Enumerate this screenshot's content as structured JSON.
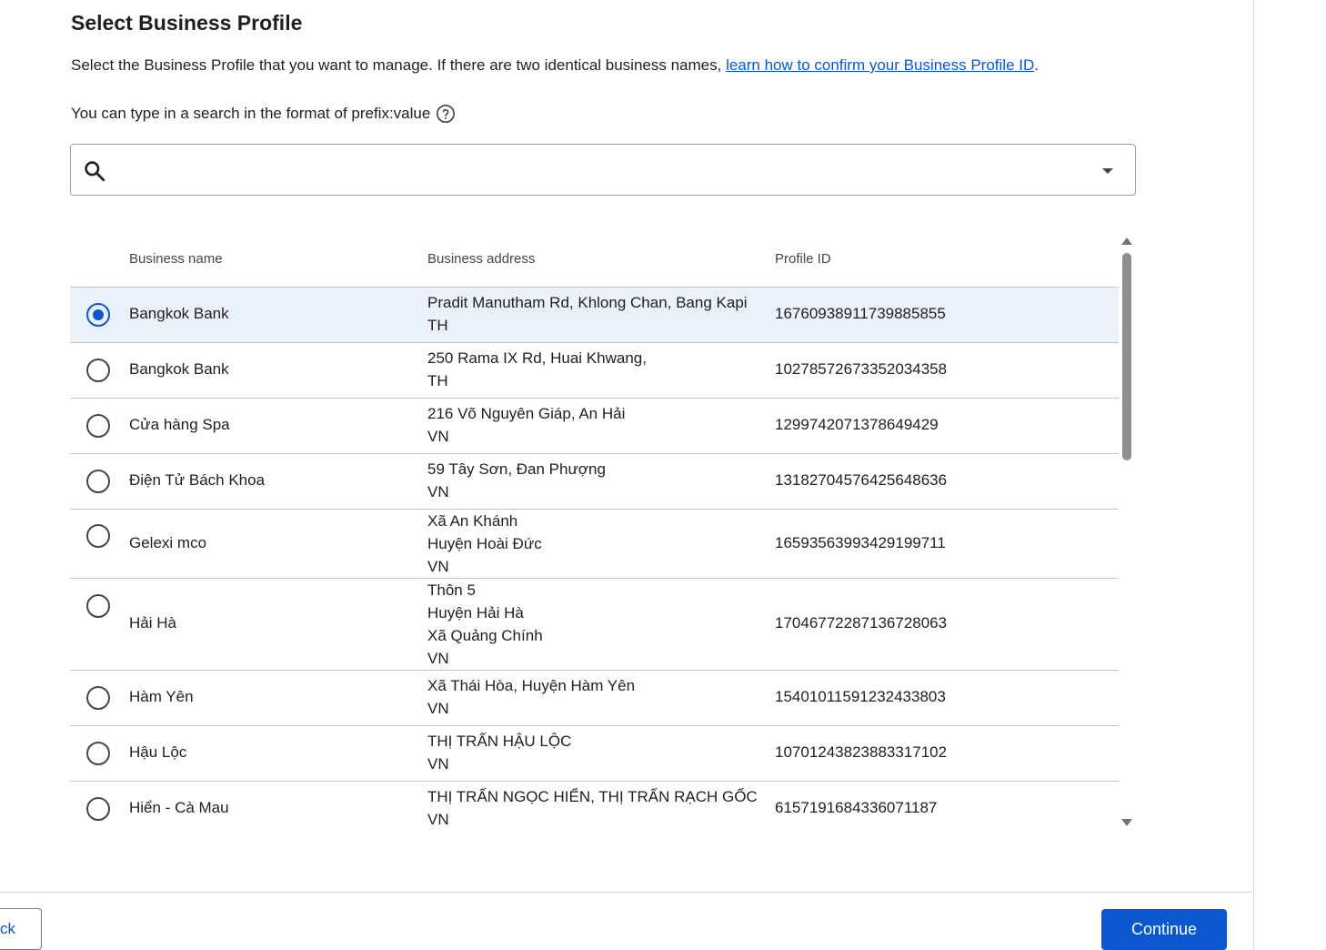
{
  "header": {
    "title": "Select Business Profile",
    "description": "Select the Business Profile that you want to manage. If there are two identical business names, ",
    "link_text": "learn how to confirm your Business Profile ID",
    "description_end": ".",
    "search_hint": "You can type in a search in the format of prefix:value"
  },
  "search": {
    "value": "",
    "placeholder": ""
  },
  "table": {
    "columns": [
      "Business name",
      "Business address",
      "Profile ID"
    ],
    "rows": [
      {
        "name": "Bangkok Bank",
        "address": [
          "Pradit Manutham Rd, Khlong Chan, Bang Kapi",
          "TH"
        ],
        "id": "16760938911739885855",
        "selected": true
      },
      {
        "name": "Bangkok Bank",
        "address": [
          "250 Rama IX Rd, Huai Khwang,",
          "TH"
        ],
        "id": "10278572673352034358",
        "selected": false
      },
      {
        "name": "Cửa hàng Spa",
        "address": [
          "216 Võ Nguyên Giáp, An Hải",
          "VN"
        ],
        "id": "1299742071378649429",
        "selected": false
      },
      {
        "name": "Điện Tử Bách Khoa",
        "address": [
          "59 Tây Sơn, Đan Phượng",
          "VN"
        ],
        "id": "13182704576425648636",
        "selected": false
      },
      {
        "name": "Gelexi mco",
        "address": [
          "Xã An Khánh",
          "Huyện Hoài Đức",
          "VN"
        ],
        "id": "16593563993429199711",
        "selected": false
      },
      {
        "name": "Hải Hà",
        "address": [
          "Thôn 5",
          "Huyện Hải Hà",
          "Xã Quảng Chính",
          "VN"
        ],
        "id": "17046772287136728063",
        "selected": false
      },
      {
        "name": "Hàm Yên",
        "address": [
          "Xã Thái Hòa, Huyện Hàm Yên",
          "VN"
        ],
        "id": "15401011591232433803",
        "selected": false
      },
      {
        "name": "Hậu Lộc",
        "address": [
          "THỊ TRẤN HẬU LỘC",
          "VN"
        ],
        "id": "10701243823883317102",
        "selected": false
      },
      {
        "name": "Hiển - Cà Mau",
        "address": [
          "THỊ TRẤN NGỌC HIỂN, THỊ TRẤN RẠCH GỐC",
          "VN"
        ],
        "id": "6157191684336071187",
        "selected": false
      }
    ]
  },
  "footer": {
    "back_label": "ck",
    "continue_label": "Continue"
  },
  "colors": {
    "accent": "#0b57d0",
    "selected_row": "#eaf1fb"
  }
}
